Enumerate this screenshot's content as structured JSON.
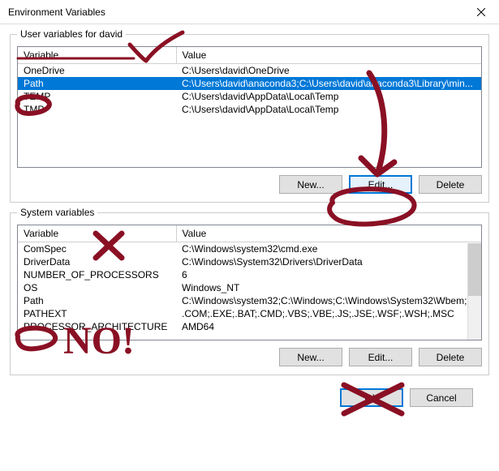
{
  "window": {
    "title": "Environment Variables"
  },
  "user_section": {
    "label": "User variables for david",
    "columns": {
      "var": "Variable",
      "val": "Value"
    },
    "rows": [
      {
        "var": "OneDrive",
        "val": "C:\\Users\\david\\OneDrive",
        "selected": false
      },
      {
        "var": "Path",
        "val": "C:\\Users\\david\\anaconda3;C:\\Users\\david\\anaconda3\\Library\\min...",
        "selected": true
      },
      {
        "var": "TEMP",
        "val": "C:\\Users\\david\\AppData\\Local\\Temp",
        "selected": false
      },
      {
        "var": "TMP",
        "val": "C:\\Users\\david\\AppData\\Local\\Temp",
        "selected": false
      }
    ],
    "buttons": {
      "new": "New...",
      "edit": "Edit...",
      "delete": "Delete"
    }
  },
  "system_section": {
    "label": "System variables",
    "columns": {
      "var": "Variable",
      "val": "Value"
    },
    "rows": [
      {
        "var": "ComSpec",
        "val": "C:\\Windows\\system32\\cmd.exe"
      },
      {
        "var": "DriverData",
        "val": "C:\\Windows\\System32\\Drivers\\DriverData"
      },
      {
        "var": "NUMBER_OF_PROCESSORS",
        "val": "6"
      },
      {
        "var": "OS",
        "val": "Windows_NT"
      },
      {
        "var": "Path",
        "val": "C:\\Windows\\system32;C:\\Windows;C:\\Windows\\System32\\Wbem;..."
      },
      {
        "var": "PATHEXT",
        "val": ".COM;.EXE;.BAT;.CMD;.VBS;.VBE;.JS;.JSE;.WSF;.WSH;.MSC"
      },
      {
        "var": "PROCESSOR_ARCHITECTURE",
        "val": "AMD64"
      }
    ],
    "buttons": {
      "new": "New...",
      "edit": "Edit...",
      "delete": "Delete"
    }
  },
  "footer": {
    "ok": "OK",
    "cancel": "Cancel"
  },
  "annotations": {
    "color": "#8a1024",
    "user_header_check": true,
    "user_path_circle": true,
    "edit_circle_arrow": true,
    "system_x": true,
    "system_no_text": "NO!",
    "system_path_circle": true,
    "system_edit_x": true
  }
}
